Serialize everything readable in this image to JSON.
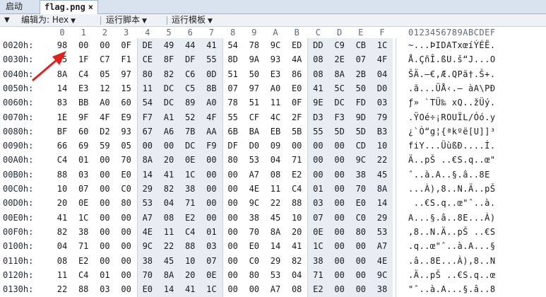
{
  "tabs": [
    {
      "label": "启动"
    },
    {
      "label": "flag.png",
      "close": "×"
    }
  ],
  "toolbar": {
    "collapse": "▼",
    "edit_as": "编辑为: Hex",
    "run_script": "运行脚本",
    "run_template": "运行模板",
    "dropdown": "▼"
  },
  "hex_header": {
    "columns": [
      "0",
      "1",
      "2",
      "3",
      "4",
      "5",
      "6",
      "7",
      "8",
      "9",
      "A",
      "B",
      "C",
      "D",
      "E",
      "F"
    ],
    "ascii": "0123456789ABCDEF"
  },
  "rows": [
    {
      "addr": "0020h:",
      "bytes": [
        "98",
        "00",
        "00",
        "0F",
        "DE",
        "49",
        "44",
        "41",
        "54",
        "78",
        "9C",
        "ED",
        "DD",
        "C9",
        "CB",
        "1C"
      ],
      "ascii": "~...ÞIDATxœíÝÉË."
    },
    {
      "addr": "0030h:",
      "bytes": [
        "C5",
        "1F",
        "C7",
        "F1",
        "CE",
        "8F",
        "DF",
        "55",
        "8D",
        "9A",
        "93",
        "4A",
        "08",
        "2E",
        "07",
        "4F"
      ],
      "ascii": "Å.ÇñÎ.ßU.š“J...O"
    },
    {
      "addr": "0040h:",
      "bytes": [
        "8A",
        "C4",
        "05",
        "97",
        "80",
        "82",
        "C6",
        "0D",
        "51",
        "50",
        "E3",
        "86",
        "08",
        "8A",
        "2B",
        "04"
      ],
      "ascii": "ŠÄ.—€‚Æ.QPã†.Š+."
    },
    {
      "addr": "0050h:",
      "bytes": [
        "14",
        "E3",
        "12",
        "15",
        "11",
        "DC",
        "C5",
        "8B",
        "07",
        "97",
        "A0",
        "E0",
        "41",
        "5C",
        "50",
        "D0"
      ],
      "ascii": ".ã...ÜÅ‹.— àA\\PÐ"
    },
    {
      "addr": "0060h:",
      "bytes": [
        "83",
        "BB",
        "A0",
        "60",
        "54",
        "DC",
        "89",
        "A0",
        "78",
        "51",
        "11",
        "0F",
        "9E",
        "DC",
        "FD",
        "03"
      ],
      "ascii": "ƒ» `TÜ‰ xQ..žÜý."
    },
    {
      "addr": "0070h:",
      "bytes": [
        "1E",
        "9F",
        "4F",
        "E9",
        "F7",
        "A1",
        "52",
        "4F",
        "55",
        "CF",
        "4C",
        "2F",
        "D3",
        "F3",
        "9D",
        "79"
      ],
      "ascii": ".ŸOé÷¡ROUÏL/Óó.y"
    },
    {
      "addr": "0080h:",
      "bytes": [
        "BF",
        "60",
        "D2",
        "93",
        "67",
        "A6",
        "7B",
        "AA",
        "6B",
        "BA",
        "EB",
        "5B",
        "55",
        "5D",
        "5D",
        "B3"
      ],
      "ascii": "¿`Ò“g¦{ªkºë[U]]³"
    },
    {
      "addr": "0090h:",
      "bytes": [
        "66",
        "69",
        "59",
        "05",
        "00",
        "00",
        "DC",
        "F9",
        "DF",
        "D0",
        "09",
        "00",
        "00",
        "00",
        "CD",
        "10"
      ],
      "ascii": "fiY...ÜùßÐ....Í."
    },
    {
      "addr": "00A0h:",
      "bytes": [
        "C4",
        "01",
        "00",
        "70",
        "8A",
        "20",
        "0E",
        "00",
        "80",
        "53",
        "04",
        "71",
        "00",
        "00",
        "9C",
        "22"
      ],
      "ascii": "Ä..pŠ ..€S.q..œ\""
    },
    {
      "addr": "00B0h:",
      "bytes": [
        "88",
        "03",
        "00",
        "E0",
        "14",
        "41",
        "1C",
        "00",
        "00",
        "A7",
        "08",
        "E2",
        "00",
        "00",
        "38",
        "45"
      ],
      "ascii": "ˆ..à.A..§.â..8E"
    },
    {
      "addr": "00C0h:",
      "bytes": [
        "10",
        "07",
        "00",
        "C0",
        "29",
        "82",
        "38",
        "00",
        "00",
        "4E",
        "11",
        "C4",
        "01",
        "00",
        "70",
        "8A"
      ],
      "ascii": "...À)‚8..N.Ä..pŠ"
    },
    {
      "addr": "00D0h:",
      "bytes": [
        "20",
        "0E",
        "00",
        "80",
        "53",
        "04",
        "71",
        "00",
        "00",
        "9C",
        "22",
        "88",
        "03",
        "00",
        "E0",
        "14"
      ],
      "ascii": " ..€S.q..œ\"ˆ..à."
    },
    {
      "addr": "00E0h:",
      "bytes": [
        "41",
        "1C",
        "00",
        "00",
        "A7",
        "08",
        "E2",
        "00",
        "00",
        "38",
        "45",
        "10",
        "07",
        "00",
        "C0",
        "29"
      ],
      "ascii": "A...§.â..8E...À)"
    },
    {
      "addr": "00F0h:",
      "bytes": [
        "82",
        "38",
        "00",
        "00",
        "4E",
        "11",
        "C4",
        "01",
        "00",
        "70",
        "8A",
        "20",
        "0E",
        "00",
        "80",
        "53"
      ],
      "ascii": "‚8..N.Ä..pŠ ..€S"
    },
    {
      "addr": "0100h:",
      "bytes": [
        "04",
        "71",
        "00",
        "00",
        "9C",
        "22",
        "88",
        "03",
        "00",
        "E0",
        "14",
        "41",
        "1C",
        "00",
        "00",
        "A7"
      ],
      "ascii": ".q..œ\"ˆ..à.A...§"
    },
    {
      "addr": "0110h:",
      "bytes": [
        "08",
        "E2",
        "00",
        "00",
        "38",
        "45",
        "10",
        "07",
        "00",
        "C0",
        "29",
        "82",
        "38",
        "00",
        "00",
        "4E"
      ],
      "ascii": ".â..8E...À)‚8..N"
    },
    {
      "addr": "0120h:",
      "bytes": [
        "11",
        "C4",
        "01",
        "00",
        "70",
        "8A",
        "20",
        "0E",
        "00",
        "80",
        "53",
        "04",
        "71",
        "00",
        "00",
        "9C"
      ],
      "ascii": ".Ä..pŠ ..€S.q..œ"
    },
    {
      "addr": "0130h:",
      "bytes": [
        "22",
        "88",
        "03",
        "00",
        "E0",
        "14",
        "41",
        "1C",
        "00",
        "00",
        "A7",
        "08",
        "E2",
        "00",
        "00",
        "38"
      ],
      "ascii": "\"ˆ..à.A...§.â..8"
    }
  ],
  "colors": {
    "arrow": "#e0201c",
    "stripe": "#e8edf3"
  }
}
